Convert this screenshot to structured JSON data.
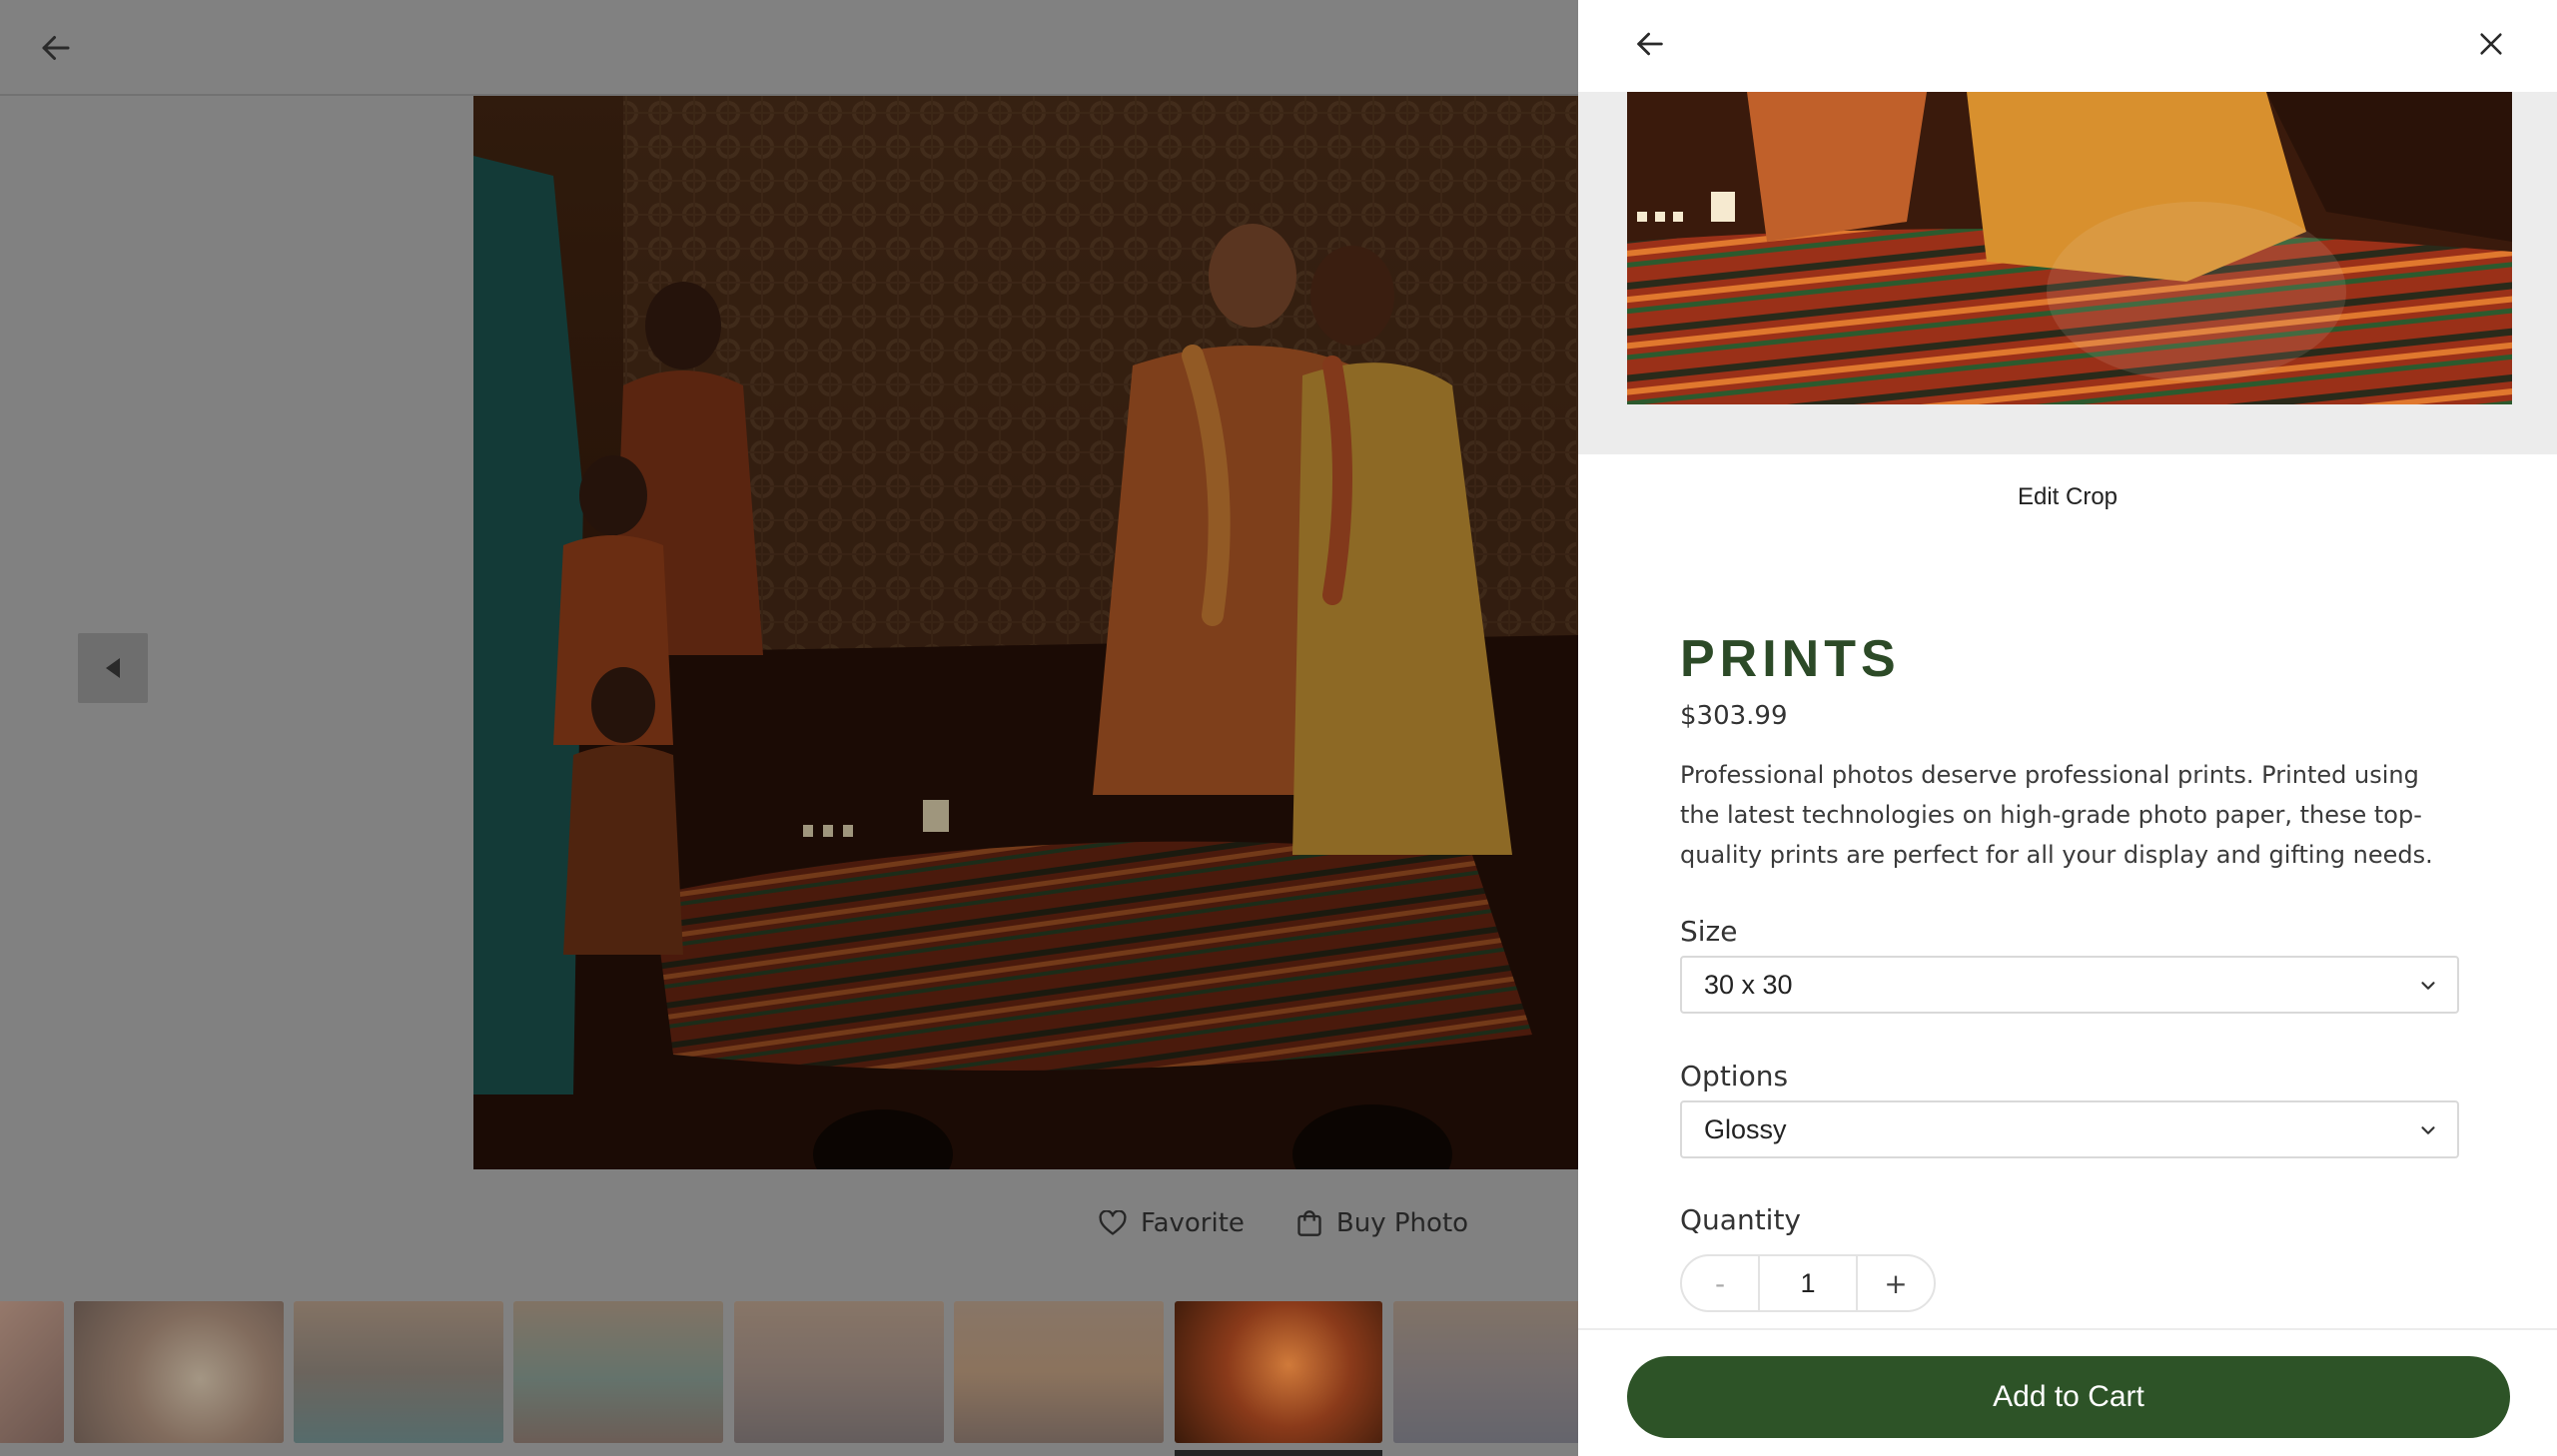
{
  "viewer": {
    "actions": {
      "favorite_label": "Favorite",
      "buy_label": "Buy Photo"
    }
  },
  "panel": {
    "edit_crop_label": "Edit Crop",
    "product": {
      "title": "PRINTS",
      "price": "$303.99",
      "description": "Professional photos deserve professional prints. Printed using the latest technologies on high-grade photo paper, these top-quality prints are perfect for all your display and gifting needs."
    },
    "size": {
      "label": "Size",
      "value": "30 x 30"
    },
    "options": {
      "label": "Options",
      "value": "Glossy"
    },
    "quantity": {
      "label": "Quantity",
      "decrement": "-",
      "value": "1",
      "increment": "+"
    },
    "add_to_cart_label": "Add to Cart"
  },
  "icons": {
    "viewer_back": "arrow-left-icon",
    "prev": "caret-left-icon",
    "favorite": "heart-icon",
    "buy": "shopping-bag-icon",
    "panel_back": "arrow-left-icon",
    "close": "close-icon",
    "chevron": "chevron-down-icon"
  },
  "colors": {
    "brand_green": "#2d5327",
    "title_green": "#2c4a27"
  }
}
